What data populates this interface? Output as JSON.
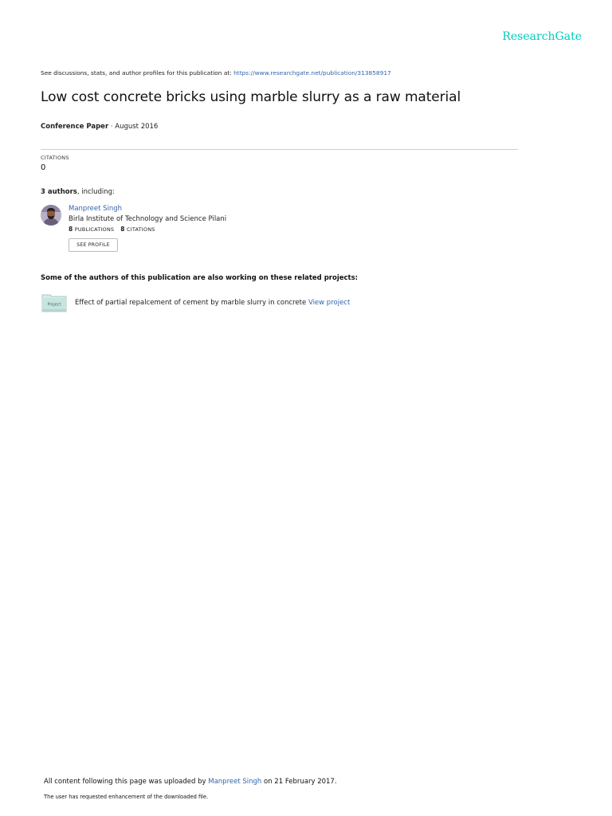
{
  "brand": {
    "logo_text": "ResearchGate",
    "accent_color": "#00ccbb",
    "link_color": "#3366aa"
  },
  "header": {
    "discussion_text": "See discussions, stats, and author profiles for this publication at:",
    "publication_url": "https://www.researchgate.net/publication/313858917"
  },
  "publication": {
    "title": "Low cost concrete bricks using marble slurry as a raw material",
    "type": "Conference Paper",
    "separator": " · ",
    "date": "August 2016"
  },
  "citations": {
    "label": "CITATIONS",
    "value": "0"
  },
  "authors": {
    "count_text": "3 authors",
    "suffix": ", including:",
    "list": [
      {
        "name": "Manpreet Singh",
        "institution": "Birla Institute of Technology and Science Pilani",
        "publications_count": "8",
        "publications_label": "PUBLICATIONS",
        "citations_count": "8",
        "citations_label": "CITATIONS",
        "button_label": "SEE PROFILE",
        "avatar_icon": "author-photo"
      }
    ]
  },
  "related": {
    "heading": "Some of the authors of this publication are also working on these related projects:",
    "projects": [
      {
        "icon_label": "Project",
        "title": "Effect of partial repalcement of cement by marble slurry in concrete",
        "link_label": "View project"
      }
    ]
  },
  "footer": {
    "upload_prefix": "All content following this page was uploaded by",
    "uploader": "Manpreet Singh",
    "upload_suffix": "on 21 February 2017.",
    "request_note": "The user has requested enhancement of the downloaded file."
  }
}
